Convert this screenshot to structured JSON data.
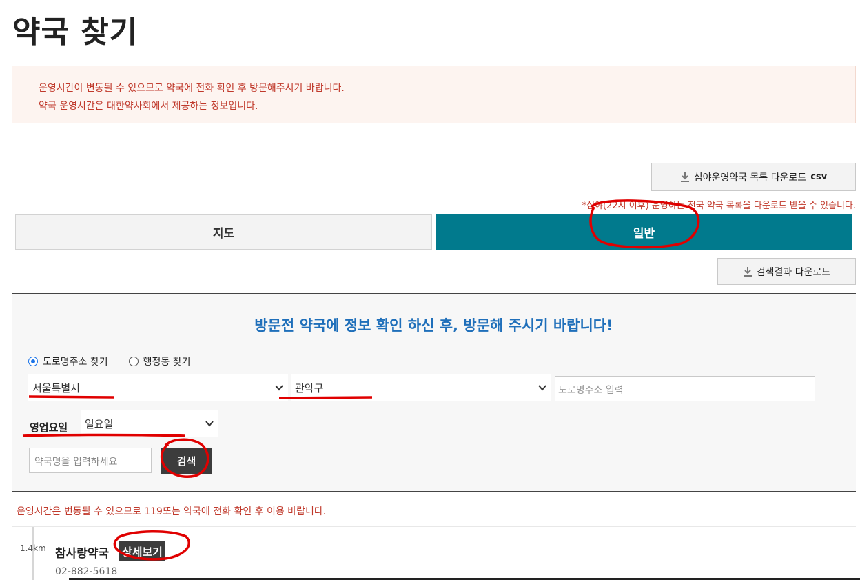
{
  "page": {
    "title": "약국 찾기"
  },
  "notice": {
    "line1": "운영시간이 변동될 수 있으므로 약국에 전화 확인 후 방문해주시기 바랍니다.",
    "line2": "약국 운영시간은 대한약사회에서 제공하는 정보입니다."
  },
  "night_download": {
    "label": "심야운영약국 목록 다운로드",
    "suffix": "csv",
    "note": "*심야(22시 이후) 운영하는 전국 약국 목록을 다운로드 받을 수 있습니다."
  },
  "tabs": [
    {
      "label": "지도",
      "active": false
    },
    {
      "label": "일반",
      "active": true
    }
  ],
  "result_download": {
    "label": "검색결과 다운로드"
  },
  "search": {
    "heading": "방문전 약국에 정보 확인 하신 후, 방문해 주시기 바랍니다!",
    "radio_road": "도로명주소 찾기",
    "radio_admin": "행정동 찾기",
    "city": "서울특별시",
    "district": "관악구",
    "address_placeholder": "도로명주소 입력",
    "day_label": "영업요일",
    "day": "일요일",
    "name_placeholder": "약국명을 입력하세요",
    "button": "검색"
  },
  "warning": "운영시간은 변동될 수 있으므로 119또는 약국에 전화 확인 후 이용 바랍니다.",
  "results": [
    {
      "distance": "1.4km",
      "name": "참사랑약국",
      "detail": "상세보기",
      "phone": "02-882-5618"
    }
  ],
  "colors": {
    "accent": "#017a8d",
    "heading_blue": "#1f6fba",
    "warning_red": "#c0392b",
    "annotation": "#e00000"
  }
}
